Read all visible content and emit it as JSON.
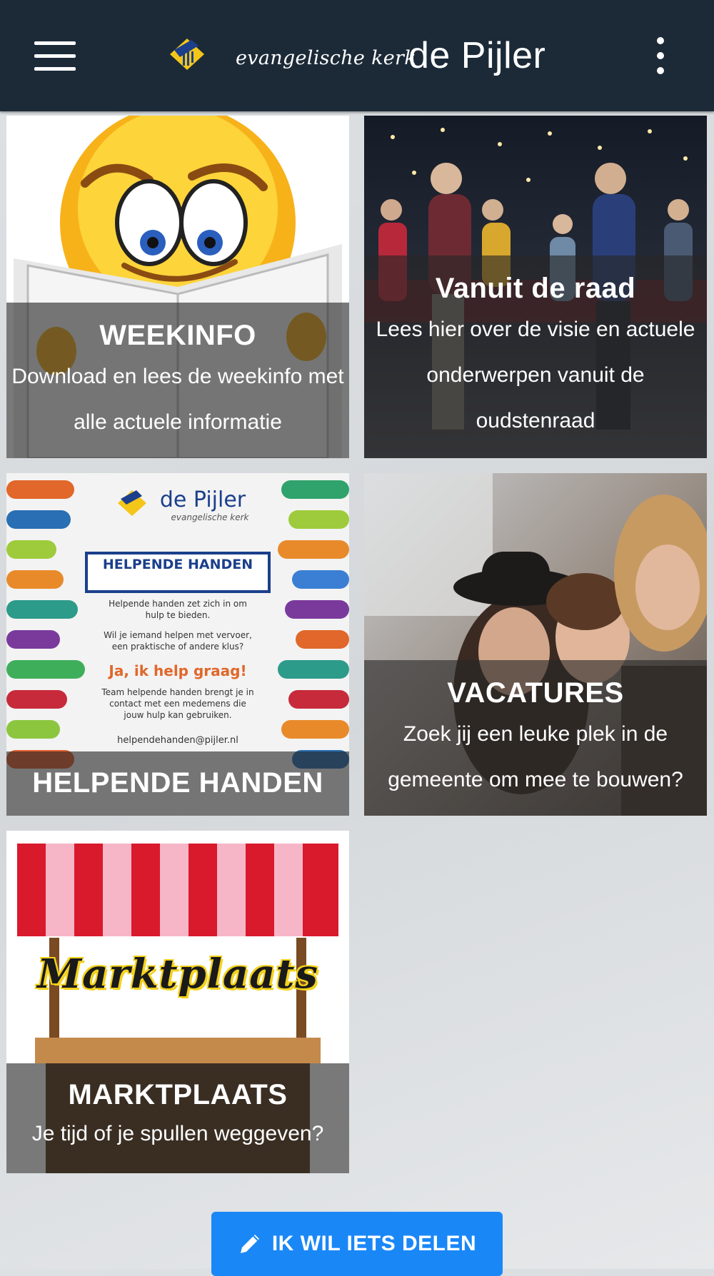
{
  "header": {
    "brand_small": "evangelische kerk",
    "brand_large": "de Pijler",
    "menu_icon": "hamburger-icon",
    "more_icon": "more-vertical-icon"
  },
  "tiles": [
    {
      "title": "WEEKINFO",
      "description": "Download en lees de weekinfo met alle actuele informatie"
    },
    {
      "title": "Vanuit de raad",
      "description": "Lees hier over de visie en actuele onderwerpen vanuit de oudstenraad"
    },
    {
      "title": "HELPENDE HANDEN",
      "description": "",
      "poster": {
        "logo": "de Pijler",
        "logo_sub": "evangelische kerk",
        "heading": "HELPENDE HANDEN",
        "line1": "Helpende handen zet zich in om hulp te bieden.",
        "line2": "Wil je iemand helpen met vervoer, een praktische of andere klus?",
        "cta": "Ja, ik help graag!",
        "line3": "Team helpende handen brengt je in contact met een medemens die jouw hulp kan gebruiken.",
        "email": "helpendehanden@pijler.nl"
      }
    },
    {
      "title": "VACATURES",
      "description": "Zoek jij een leuke plek in de gemeente om mee te bouwen?"
    },
    {
      "title": "MARKTPLAATS",
      "description": "Je tijd of je spullen weggeven?",
      "sign": "Marktplaats"
    }
  ],
  "share_button": {
    "label": "IK WIL IETS DELEN",
    "icon": "pencil-icon"
  },
  "colors": {
    "header": "#1c2a38",
    "button": "#1a87f7",
    "overlay": "#262626"
  }
}
